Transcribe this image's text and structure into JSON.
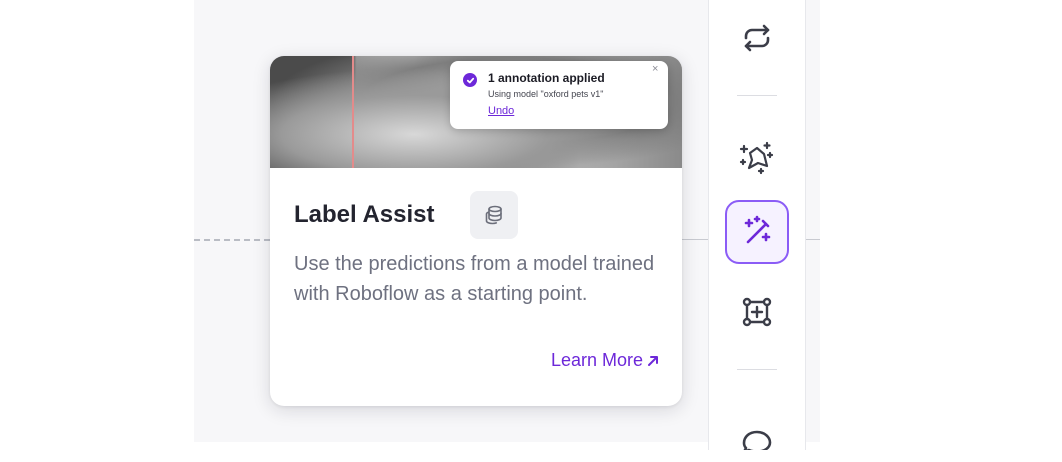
{
  "toast": {
    "title": "1 annotation applied",
    "subtitle": "Using model \"oxford pets v1\"",
    "undo_label": "Undo",
    "close_glyph": "×"
  },
  "card": {
    "title": "Label Assist",
    "description": "Use the predictions from a model trained with Roboflow as a starting point.",
    "learn_more_label": "Learn More",
    "badge_icon": "coin-stack-icon",
    "learn_more_icon": "arrow-up-right-icon"
  },
  "toolbar": {
    "tools": [
      {
        "name": "repeat-previous-tool",
        "icon": "repeat-icon",
        "active": false
      },
      {
        "name": "smart-polygon-tool",
        "icon": "sparkle-polygon-icon",
        "active": false
      },
      {
        "name": "label-assist-tool",
        "icon": "magic-wand-icon",
        "active": true
      },
      {
        "name": "bounding-box-tool",
        "icon": "bounding-box-sparkle-icon",
        "active": false
      },
      {
        "name": "comment-tool",
        "icon": "speech-bubble-icon",
        "active": false
      }
    ]
  },
  "colors": {
    "accent": "#6d28d9",
    "active_border": "#8b5cf6",
    "title": "#23242f",
    "description": "#6e7180"
  }
}
